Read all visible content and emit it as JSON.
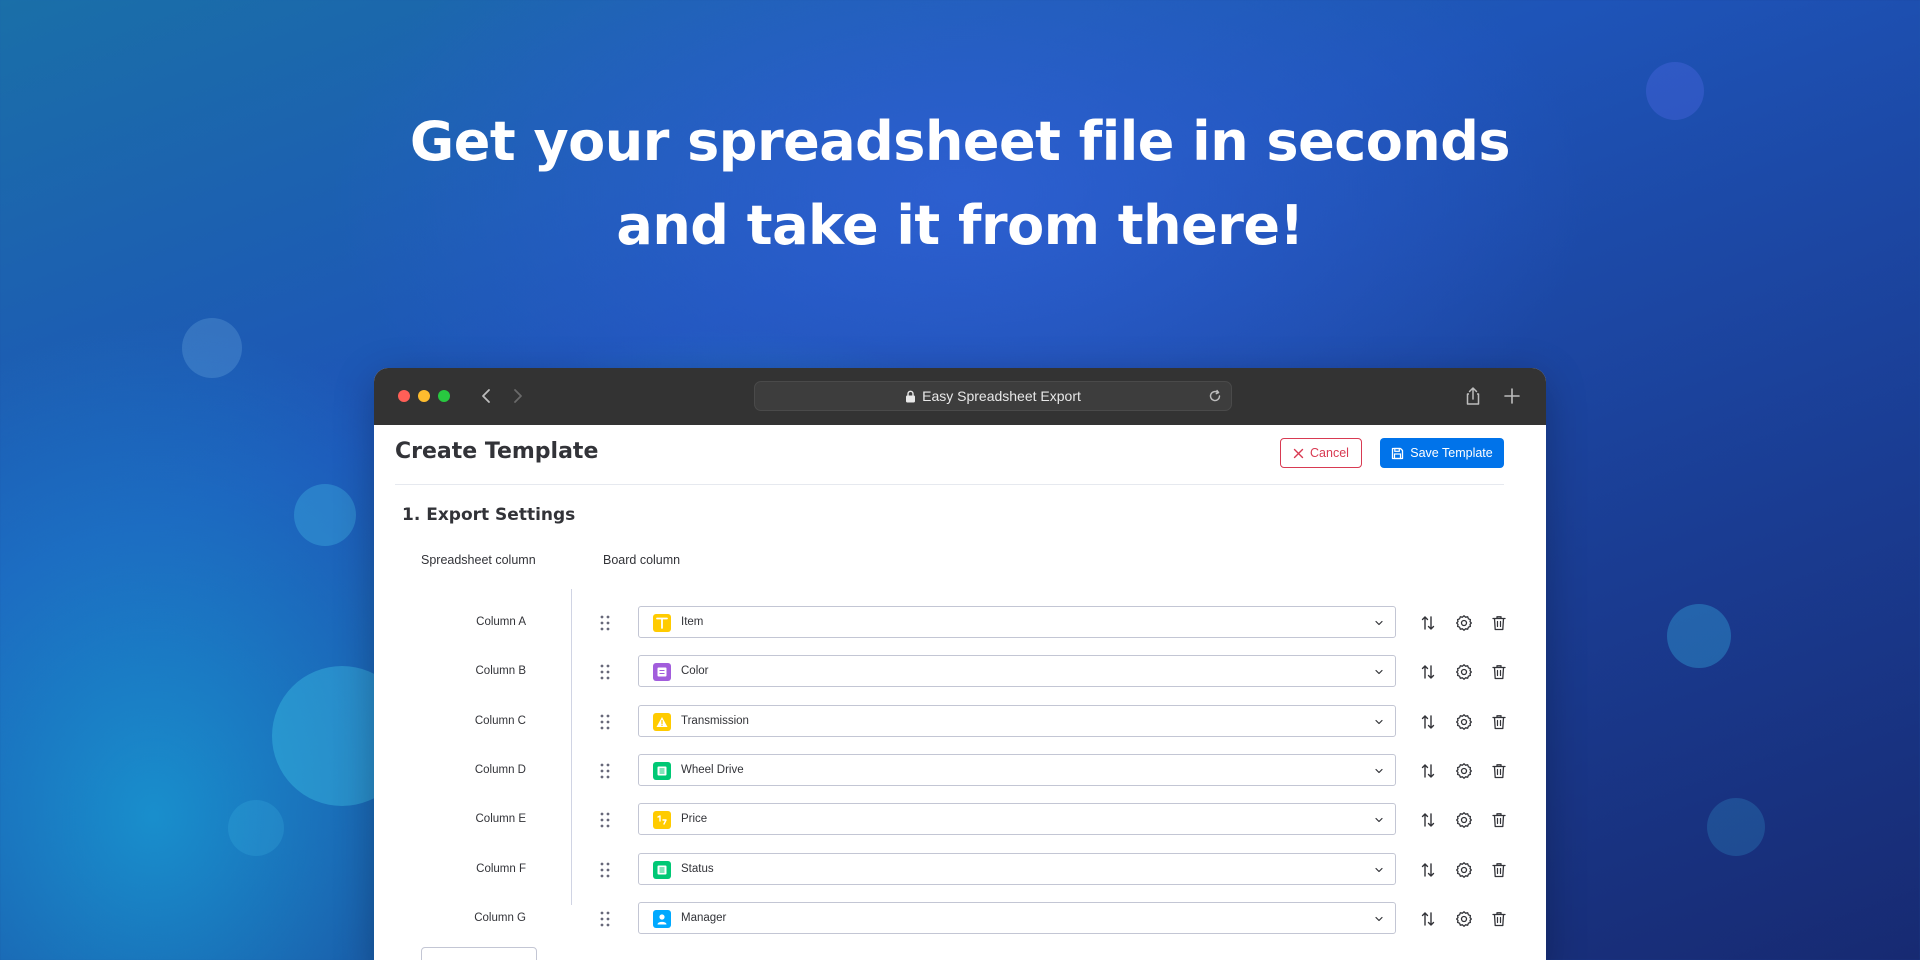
{
  "hero": {
    "line1": "Get your spreadsheet file in seconds",
    "line2": "and take it from there!"
  },
  "browser": {
    "url_title": "Easy Spreadsheet Export"
  },
  "page": {
    "title": "Create Template",
    "cancel_label": "Cancel",
    "save_label": "Save Template",
    "section_title": "1. Export Settings",
    "spreadsheet_column_header": "Spreadsheet column",
    "board_column_header": "Board column"
  },
  "rows": [
    {
      "label": "Column A",
      "value": "Item",
      "icon": "text-type-icon",
      "color": "#ffcb00"
    },
    {
      "label": "Column B",
      "value": "Color",
      "icon": "dropdown-type-icon",
      "color": "#a25ddc"
    },
    {
      "label": "Column C",
      "value": "Transmission",
      "icon": "warning-type-icon",
      "color": "#ffcb00"
    },
    {
      "label": "Column D",
      "value": "Wheel Drive",
      "icon": "status-type-icon",
      "color": "#00c875"
    },
    {
      "label": "Column E",
      "value": "Price",
      "icon": "number-type-icon",
      "color": "#ffcb00"
    },
    {
      "label": "Column F",
      "value": "Status",
      "icon": "status-type-icon",
      "color": "#00c875"
    },
    {
      "label": "Column G",
      "value": "Manager",
      "icon": "people-type-icon",
      "color": "#00a9ff"
    }
  ],
  "colors": {
    "primary": "#0073ea",
    "danger": "#d83a52",
    "text": "#323338"
  }
}
